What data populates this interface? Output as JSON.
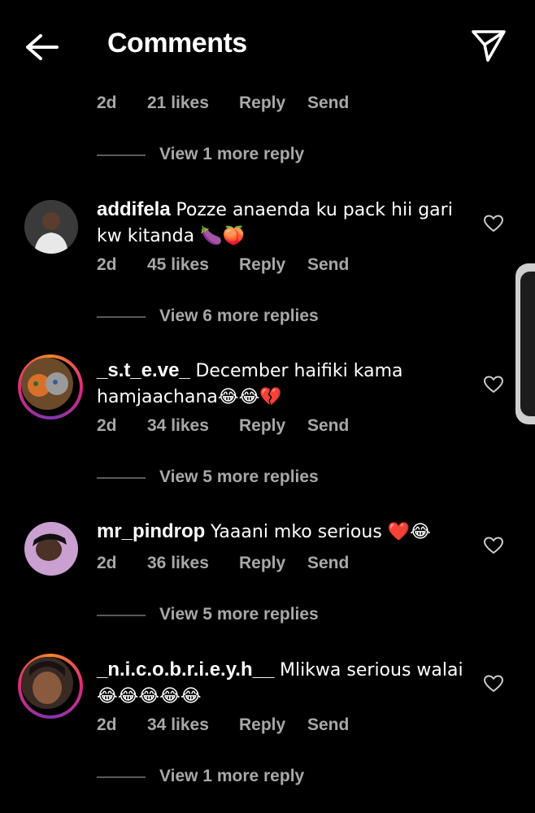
{
  "header": {
    "title": "Comments",
    "back_icon": "arrow-left-icon",
    "share_icon": "paper-plane-icon"
  },
  "top_meta": {
    "time": "2d",
    "likes": "21 likes",
    "reply": "Reply",
    "send": "Send"
  },
  "top_more": "View 1 more reply",
  "comments": [
    {
      "username": "addifela",
      "text": "Pozze anaenda ku pack hii gari kw kitanda 🍆🍑",
      "time": "2d",
      "likes": "45 likes",
      "reply": "Reply",
      "send": "Send",
      "more": "View 6 more replies"
    },
    {
      "username": "_s.t_e.ve_",
      "text": "December haifiki kama hamjaachana😂😂💔",
      "time": "2d",
      "likes": "34 likes",
      "reply": "Reply",
      "send": "Send",
      "more": "View 5 more replies"
    },
    {
      "username": "mr_pindrop",
      "text": "Yaaani mko serious ❤️😂",
      "time": "2d",
      "likes": "36 likes",
      "reply": "Reply",
      "send": "Send",
      "more": "View 5 more replies"
    },
    {
      "username": "_n.i.c.o.b.r.i.e.y.h__",
      "text": "Mlikwa serious walai 😂😂😂😂😂",
      "time": "2d",
      "likes": "34 likes",
      "reply": "Reply",
      "send": "Send",
      "more": "View 1 more reply"
    }
  ],
  "colors": {
    "background": "#000000",
    "muted": "#a8a8a8",
    "story_ring": "#dd2a7b"
  }
}
